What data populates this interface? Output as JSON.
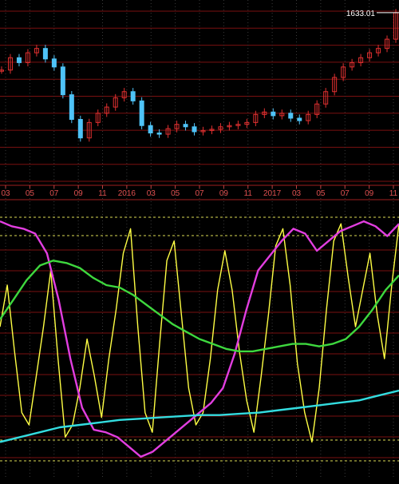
{
  "chart_data": [
    {
      "type": "candlestick",
      "title": "",
      "last_value_label": "1633.01",
      "x_tick_labels": [
        "03",
        "05",
        "07",
        "09",
        "11",
        "2016",
        "03",
        "05",
        "07",
        "09",
        "11",
        "2017",
        "03",
        "05",
        "07",
        "09",
        "11"
      ],
      "series": [
        {
          "values": [
            1540,
            1560,
            1552,
            1568,
            1575,
            1558,
            1545,
            1500,
            1460,
            1430,
            1455,
            1470,
            1480,
            1495,
            1505,
            1490,
            1450,
            1438,
            1436,
            1445,
            1452,
            1448,
            1440,
            1442,
            1444,
            1448,
            1450,
            1452,
            1455,
            1468,
            1472,
            1466,
            1470,
            1462,
            1458,
            1468,
            1485,
            1505,
            1528,
            1545,
            1552,
            1560,
            1568,
            1575,
            1590,
            1633
          ]
        }
      ]
    },
    {
      "type": "line",
      "title": "",
      "series": [
        {
          "color": "#ffff44",
          "values": [
            0.55,
            0.72,
            0.45,
            0.2,
            0.15,
            0.35,
            0.55,
            0.78,
            0.42,
            0.1,
            0.15,
            0.3,
            0.5,
            0.35,
            0.18,
            0.42,
            0.62,
            0.85,
            0.95,
            0.55,
            0.2,
            0.12,
            0.48,
            0.82,
            0.9,
            0.6,
            0.3,
            0.15,
            0.2,
            0.42,
            0.7,
            0.86,
            0.7,
            0.45,
            0.25,
            0.12,
            0.35,
            0.6,
            0.88,
            0.95,
            0.72,
            0.4,
            0.2,
            0.08,
            0.3,
            0.62,
            0.9,
            0.97,
            0.75,
            0.55,
            0.7,
            0.85,
            0.6,
            0.42,
            0.72,
            0.97
          ]
        },
        {
          "color": "#e23ee0",
          "values": [
            0.98,
            0.96,
            0.95,
            0.93,
            0.85,
            0.66,
            0.42,
            0.22,
            0.13,
            0.12,
            0.1,
            0.06,
            0.02,
            0.04,
            0.08,
            0.12,
            0.16,
            0.2,
            0.24,
            0.3,
            0.44,
            0.62,
            0.78,
            0.84,
            0.9,
            0.95,
            0.93,
            0.86,
            0.9,
            0.94,
            0.96,
            0.98,
            0.96,
            0.92,
            0.97
          ]
        },
        {
          "color": "#3ed83e",
          "values": [
            0.58,
            0.66,
            0.74,
            0.8,
            0.82,
            0.81,
            0.79,
            0.75,
            0.72,
            0.71,
            0.68,
            0.64,
            0.6,
            0.56,
            0.53,
            0.5,
            0.48,
            0.46,
            0.45,
            0.45,
            0.46,
            0.47,
            0.48,
            0.48,
            0.47,
            0.48,
            0.5,
            0.55,
            0.62,
            0.7,
            0.76
          ]
        },
        {
          "color": "#33dde0",
          "values": [
            0.08,
            0.1,
            0.12,
            0.14,
            0.15,
            0.16,
            0.17,
            0.175,
            0.18,
            0.185,
            0.19,
            0.19,
            0.195,
            0.2,
            0.21,
            0.22,
            0.23,
            0.24,
            0.25,
            0.27,
            0.29
          ]
        }
      ]
    }
  ]
}
